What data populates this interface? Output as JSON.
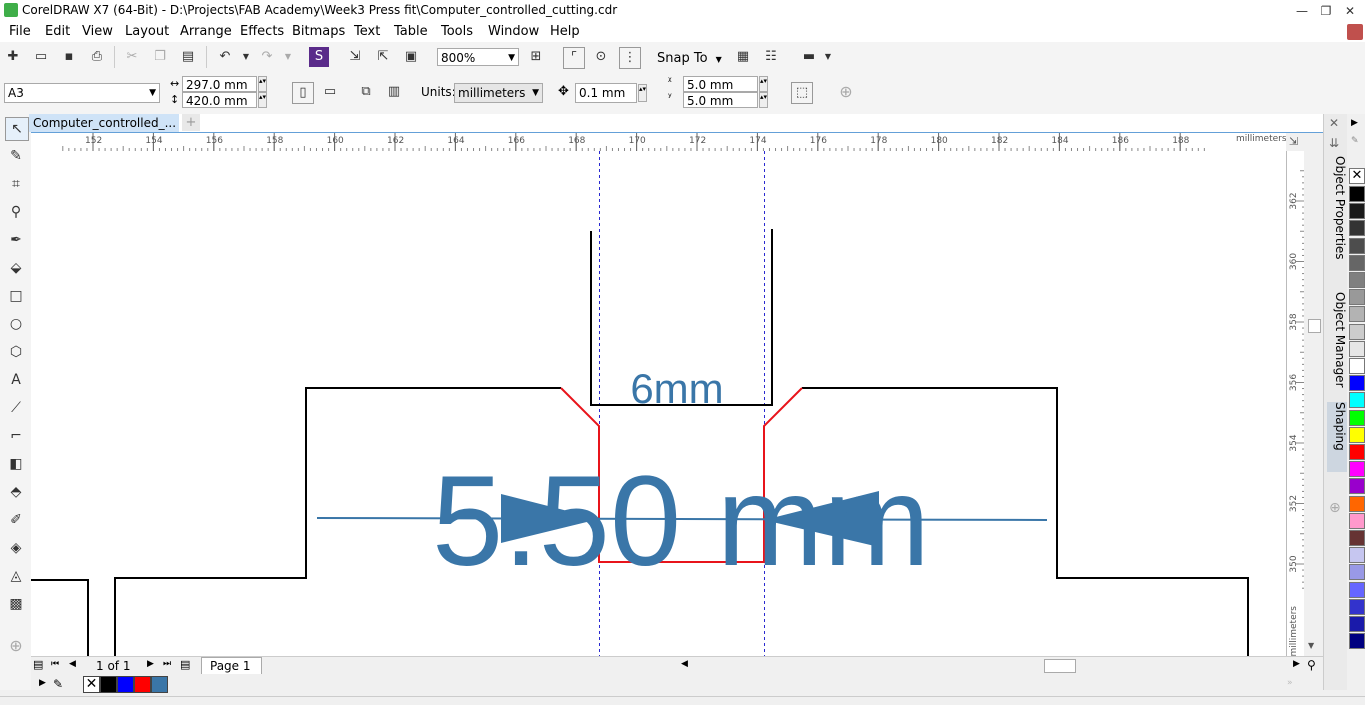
{
  "window": {
    "title": "CorelDRAW X7 (64-Bit) - D:\\Projects\\FAB Academy\\Week3 Press fit\\Computer_controlled_cutting.cdr",
    "minimize": "—",
    "maximize": "❐",
    "close": "✕"
  },
  "menu": [
    "File",
    "Edit",
    "View",
    "Layout",
    "Arrange",
    "Effects",
    "Bitmaps",
    "Text",
    "Table",
    "Tools",
    "Window",
    "Help"
  ],
  "toolbar": {
    "zoom_value": "800%",
    "snap_to_label": "Snap To"
  },
  "property_bar": {
    "page_size": "A3",
    "width": "297.0 mm",
    "height": "420.0 mm",
    "units_label": "Units:",
    "units_value": "millimeters",
    "nudge": "0.1 mm",
    "dup_x": "5.0 mm",
    "dup_y": "5.0 mm"
  },
  "document_tab": {
    "label": "Computer_controlled_...",
    "add": "+"
  },
  "ruler": {
    "h_labels": [
      "152",
      "154",
      "156",
      "158",
      "160",
      "162",
      "164",
      "166",
      "168",
      "170",
      "172",
      "174",
      "176",
      "178",
      "180",
      "182",
      "184",
      "186",
      "188"
    ],
    "h_unit": "millimeters",
    "v_labels": [
      "362",
      "360",
      "358",
      "356",
      "354",
      "352",
      "350"
    ],
    "v_unit": "millimeters"
  },
  "drawing": {
    "slot_label": "6mm",
    "dimension_label": "5.50 mm",
    "colors": {
      "outline": "#000000",
      "cut_highlight": "#e8141b",
      "dimension": "#3a76a8",
      "guide": "#2a2ad0"
    }
  },
  "dockers": [
    "Object Properties",
    "Object Manager",
    "Shaping"
  ],
  "palette_colors": [
    "#000000",
    "#1a1a1a",
    "#333333",
    "#4d4d4d",
    "#666666",
    "#808080",
    "#999999",
    "#b3b3b3",
    "#cccccc",
    "#e6e6e6",
    "#ffffff",
    "#0000ff",
    "#00ffff",
    "#00ff00",
    "#ffff00",
    "#ff0000",
    "#ff00ff",
    "#9900cc",
    "#ff6600",
    "#ff99cc",
    "#663333",
    "#c6c6f0",
    "#9999e6",
    "#6666ff",
    "#3333cc",
    "#1a1aaa",
    "#000080"
  ],
  "page_nav": {
    "page_count": "1 of 1",
    "page_tab": "Page 1"
  },
  "doc_palette_colors": [
    "#000000",
    "#0000ff",
    "#ff0000",
    "#3a76a8"
  ]
}
